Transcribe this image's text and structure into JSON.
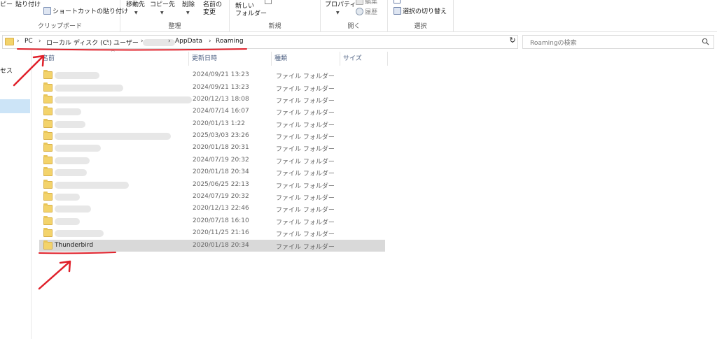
{
  "ribbon": {
    "clipboard": {
      "copy_partial": "ピー",
      "paste": "貼り付け",
      "paste_shortcut": "ショートカットの貼り付け",
      "group_label": "クリップボード"
    },
    "organize": {
      "move_to": "移動先",
      "copy_to": "コピー先",
      "delete": "削除",
      "rename_line1": "名前の",
      "rename_line2": "変更",
      "group_label": "整理"
    },
    "new": {
      "new_folder_line1": "新しい",
      "new_folder_line2": "フォルダー",
      "group_label": "新規"
    },
    "open": {
      "properties": "プロパティ",
      "edit_partial": "編集",
      "history": "履歴",
      "group_label": "開く"
    },
    "select": {
      "invert_selection": "選択の切り替え",
      "group_label": "選択"
    }
  },
  "address": {
    "crumbs": [
      "PC",
      "ローカル ディスク (C:)",
      "ユーザー",
      "AppData",
      "Roaming"
    ],
    "separator": "›"
  },
  "search": {
    "placeholder": "Roamingの検索"
  },
  "nav": {
    "partial_label": "セス"
  },
  "columns": {
    "name": "名前",
    "date": "更新日時",
    "type": "種類",
    "size": "サイズ"
  },
  "rows": [
    {
      "name": "",
      "date": "2024/09/21 13:23",
      "type": "ファイル フォルダー"
    },
    {
      "name": "",
      "date": "2024/09/21 13:23",
      "type": "ファイル フォルダー"
    },
    {
      "name": "",
      "date": "2020/12/13 18:08",
      "type": "ファイル フォルダー"
    },
    {
      "name": "",
      "date": "2024/07/14 16:07",
      "type": "ファイル フォルダー"
    },
    {
      "name": "",
      "date": "2020/01/13 1:22",
      "type": "ファイル フォルダー"
    },
    {
      "name": "",
      "date": "2025/03/03 23:26",
      "type": "ファイル フォルダー"
    },
    {
      "name": "",
      "date": "2020/01/18 20:31",
      "type": "ファイル フォルダー"
    },
    {
      "name": "",
      "date": "2024/07/19 20:32",
      "type": "ファイル フォルダー"
    },
    {
      "name": "",
      "date": "2020/01/18 20:34",
      "type": "ファイル フォルダー"
    },
    {
      "name": "",
      "date": "2025/06/25 22:13",
      "type": "ファイル フォルダー"
    },
    {
      "name": "",
      "date": "2024/07/19 20:32",
      "type": "ファイル フォルダー"
    },
    {
      "name": "",
      "date": "2020/12/13 22:46",
      "type": "ファイル フォルダー"
    },
    {
      "name": "",
      "date": "2020/07/18 16:10",
      "type": "ファイル フォルダー"
    },
    {
      "name": "",
      "date": "2020/11/25 21:16",
      "type": "ファイル フォルダー"
    },
    {
      "name": "Thunderbird",
      "date": "2020/01/18 20:34",
      "type": "ファイル フォルダー"
    }
  ],
  "colors": {
    "folder": "#f3d36b",
    "annotation": "#e0202a",
    "selected_row": "#d9d9d9",
    "nav_selected": "#cce4f7"
  },
  "icons": {
    "address": "folder-icon",
    "search": "search-icon",
    "refresh": "refresh-icon",
    "dropdown": "chevron-down-icon"
  }
}
